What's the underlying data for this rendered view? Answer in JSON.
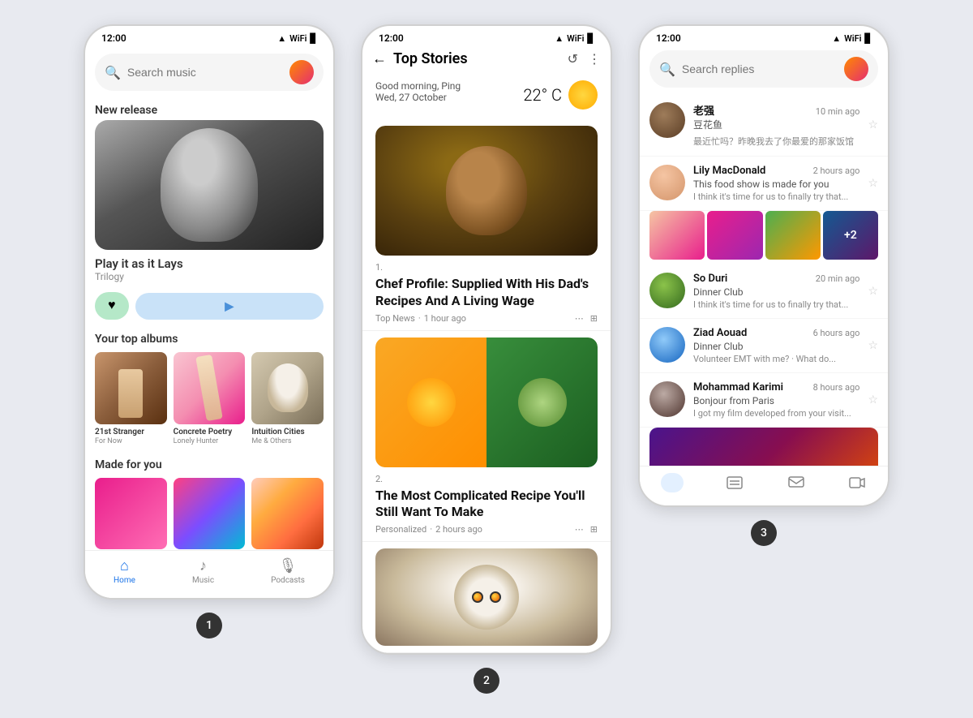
{
  "background": "#e8eaf0",
  "phones": [
    {
      "id": "phone1",
      "number": "1",
      "statusBar": {
        "time": "12:00",
        "signal": "▲▼",
        "wifi": "WiFi",
        "battery": "🔋"
      },
      "search": {
        "placeholder": "Search music"
      },
      "sections": {
        "newRelease": {
          "title": "New release",
          "trackName": "Play it as it Lays",
          "artist": "Trilogy",
          "likeBtn": "♥",
          "playBtn": "▶"
        },
        "topAlbums": {
          "title": "Your top albums",
          "items": [
            {
              "title": "21st Stranger",
              "subtitle": "For Now"
            },
            {
              "title": "Concrete Poetry",
              "subtitle": "Lonely Hunter"
            },
            {
              "title": "Intuition Cities",
              "subtitle": "Me & Others"
            }
          ]
        },
        "madeForYou": {
          "title": "Made for you"
        }
      },
      "nav": {
        "items": [
          {
            "label": "Home",
            "icon": "⌂",
            "active": true
          },
          {
            "label": "Music",
            "icon": "♪",
            "active": false
          },
          {
            "label": "Podcasts",
            "icon": "🎙",
            "active": false
          }
        ]
      }
    },
    {
      "id": "phone2",
      "number": "2",
      "statusBar": {
        "time": "12:00"
      },
      "header": {
        "title": "Top Stories",
        "backIcon": "←",
        "refreshIcon": "↺",
        "moreIcon": "⋮"
      },
      "weather": {
        "greeting": "Good morning, Ping",
        "date": "Wed, 27 October",
        "temp": "22° C"
      },
      "articles": [
        {
          "num": "1.",
          "title": "Chef Profile: Supplied With His Dad's Recipes And A Living Wage",
          "source": "Top News",
          "time": "1 hour ago"
        },
        {
          "num": "2.",
          "title": "The Most Complicated Recipe You'll Still Want To Make",
          "source": "Personalized",
          "time": "2 hours ago"
        }
      ]
    },
    {
      "id": "phone3",
      "number": "3",
      "statusBar": {
        "time": "12:00"
      },
      "search": {
        "placeholder": "Search replies"
      },
      "messages": [
        {
          "name": "老强",
          "nameLine2": "豆花鱼",
          "preview": "最近忙吗？昨晚我去了你最爱的那家饭馆",
          "time": "10 min ago",
          "hasImages": false
        },
        {
          "name": "Lily MacDonald",
          "group": "This food show is made for you",
          "preview": "I think it's time for us to finally try that...",
          "time": "2 hours ago",
          "hasImages": true
        },
        {
          "name": "So Duri",
          "group": "Dinner Club",
          "preview": "I think it's time for us to finally try that...",
          "time": "20 min ago",
          "hasImages": false
        },
        {
          "name": "Ziad Aouad",
          "group": "Dinner Club",
          "preview": "Volunteer EMT with me? · What do...",
          "time": "6 hours ago",
          "hasImages": false
        },
        {
          "name": "Mohammad Karimi",
          "group": "Bonjour from Paris",
          "preview": "I got my film developed from your visit...",
          "time": "8 hours ago",
          "hasImages": false,
          "hasPhoto": true
        }
      ],
      "nav": {
        "items": [
          {
            "icon": "📷",
            "active": true
          },
          {
            "icon": "☰",
            "active": false
          },
          {
            "icon": "□",
            "active": false
          },
          {
            "icon": "🎬",
            "active": false
          }
        ]
      }
    }
  ]
}
